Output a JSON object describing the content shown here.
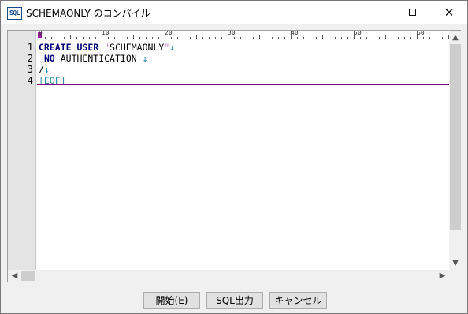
{
  "window": {
    "app_icon_text": "SQL",
    "title": "SCHEMAONLY のコンパイル",
    "controls": {
      "minimize": "─",
      "maximize": "□",
      "close": "✕"
    }
  },
  "editor": {
    "ruler": {
      "labels": [
        "0",
        "10",
        "20",
        "30",
        "40",
        "50",
        "60"
      ]
    },
    "line_numbers": [
      "1",
      "2",
      "3",
      "4"
    ],
    "lines": [
      {
        "kw1": "CREATE",
        "sp1": " ",
        "kw2": "USER",
        "sp2": " ",
        "q1": "\"",
        "str": "SCHEMAONLY",
        "q2": "\"",
        "arrow": "↓"
      },
      {
        "sp1": " ",
        "kw1": "NO",
        "sp2": " ",
        "plain": "AUTHENTICATION",
        "sp3": " ",
        "arrow": "↓"
      },
      {
        "slash": "/",
        "arrow": "↓"
      },
      {
        "eof": "[EOF]"
      }
    ],
    "scroll": {
      "up": "▲",
      "down": "▼",
      "left": "◀",
      "right": "▶"
    }
  },
  "buttons": {
    "start": {
      "label": "開始(",
      "mnemonic": "E",
      "suffix": ")"
    },
    "sql_output": {
      "mnemonic": "S",
      "label": "QL出力"
    },
    "cancel": {
      "label": "キャンセル"
    }
  }
}
